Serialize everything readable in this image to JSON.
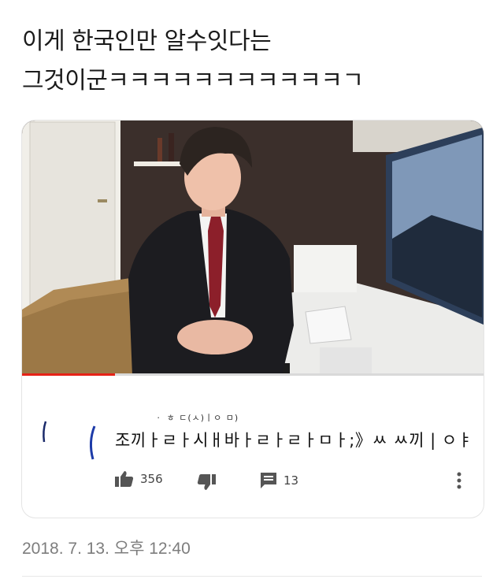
{
  "post": {
    "title_line1": "이게 한국인만 알수잇다는",
    "title_line2": "그것이군ㅋㅋㅋㅋㅋㅋㅋㅋㅋㅋㅋㄱ"
  },
  "video": {
    "progress_fraction": 0.2,
    "progress_color": "#e62117"
  },
  "comment": {
    "text_small": "ㆍ ㅎ ㄷ(ㅅ)ㅣㅇ ㅁ)",
    "text": "조끼ㅏㄹㅏ시ㅐ바ㅏㄹㅏㄹㅏㅁㅏ;》ㅆ ㅆ끼 | ㅇㅑ",
    "likes": "356",
    "replies": "13"
  },
  "icons": {
    "like": "thumbs-up-icon",
    "dislike": "thumbs-down-icon",
    "reply": "comment-icon",
    "more": "more-vertical-icon"
  },
  "meta": {
    "timestamp": "2018. 7. 13. 오후 12:40"
  }
}
